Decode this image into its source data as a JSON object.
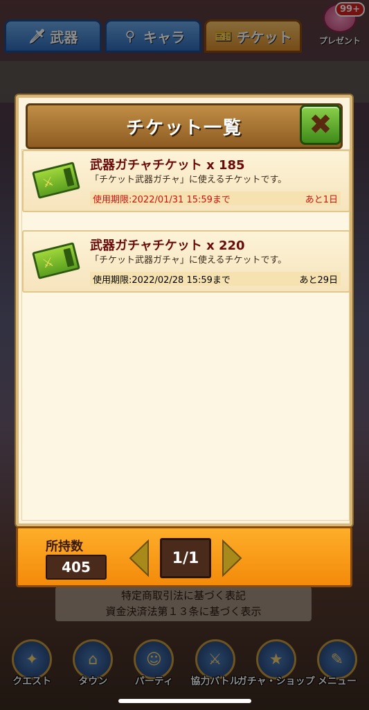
{
  "top_tabs": [
    {
      "label": "武器",
      "icon": "sword-icon"
    },
    {
      "label": "キャラ",
      "icon": "keyhole-icon"
    },
    {
      "label": "チケット",
      "icon": "ticket-icon"
    }
  ],
  "present": {
    "label": "プレゼント",
    "badge": "99+"
  },
  "dialog": {
    "title": "チケット一覧",
    "close_icon": "close-icon",
    "items": [
      {
        "name": "武器ガチャチケット x 185",
        "description": "「チケット武器ガチャ」に使えるチケットです。",
        "expiry": "使用期限:2022/01/31 15:59まで",
        "remaining": "あと1日",
        "status_color": "#d01010"
      },
      {
        "name": "武器ガチャチケット x 220",
        "description": "「チケット武器ガチャ」に使えるチケットです。",
        "expiry": "使用期限:2022/02/28 15:59まで",
        "remaining": "あと29日",
        "status_color": "#3a2a1a"
      }
    ]
  },
  "footer": {
    "owned_label": "所持数",
    "owned_value": "405",
    "page": "1/1"
  },
  "background_text": {
    "line1": "特定商取引法に基づく表記",
    "line2": "資金決済法第１３条に基づく表示"
  },
  "bottom_nav": [
    {
      "label": "クエスト",
      "icon": "map-icon"
    },
    {
      "label": "タウン",
      "icon": "town-icon"
    },
    {
      "label": "パーティ",
      "icon": "party-icon"
    },
    {
      "label": "協力バトル",
      "icon": "battle-icon"
    },
    {
      "label": "ガチャ・ショップ",
      "icon": "gacha-icon"
    },
    {
      "label": "メニュー",
      "icon": "menu-icon"
    }
  ]
}
